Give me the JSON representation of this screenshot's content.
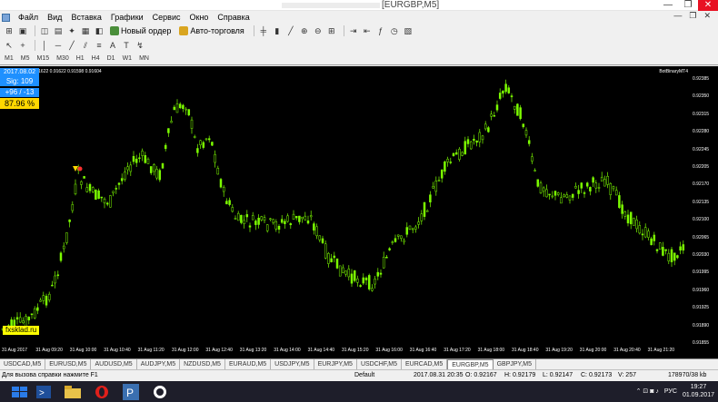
{
  "window": {
    "title": "[EURGBP,M5]",
    "controls": [
      "—",
      "❐",
      "✕"
    ]
  },
  "menu": {
    "items": [
      "Файл",
      "Вид",
      "Вставка",
      "Графики",
      "Сервис",
      "Окно",
      "Справка"
    ],
    "right": [
      "—",
      "❐",
      "✕"
    ]
  },
  "toolbar": {
    "new_order_label": "Новый ордер",
    "auto_trading_label": "Авто-торговля"
  },
  "timeframes": [
    "M1",
    "M5",
    "M15",
    "M30",
    "H1",
    "H4",
    "D1",
    "W1",
    "MN"
  ],
  "chart": {
    "symbol_info": "EURGBP,M5  0.91622 0.91622 0.91598 0.91604",
    "indicator_name": "BotBinaryMT4",
    "panel": {
      "date": "2017.08.02",
      "signal": "Sig: 109",
      "score": "+96 / -13",
      "percent": "87.96 %"
    },
    "watermark": "fxsklad.ru",
    "price_labels": [
      "0.92385",
      "0.92350",
      "0.92315",
      "0.92280",
      "0.92245",
      "0.92205",
      "0.92170",
      "0.92135",
      "0.92100",
      "0.92065",
      "0.92030",
      "0.91995",
      "0.91960",
      "0.91925",
      "0.91890",
      "0.91855"
    ],
    "time_labels": [
      "31 Aug 2017",
      "31 Aug 09:20",
      "31 Aug 10:00",
      "31 Aug 10:40",
      "31 Aug 11:20",
      "31 Aug 12:00",
      "31 Aug 12:40",
      "31 Aug 13:20",
      "31 Aug 14:00",
      "31 Aug 14:40",
      "31 Aug 15:20",
      "31 Aug 16:00",
      "31 Aug 16:40",
      "31 Aug 17:20",
      "31 Aug 18:00",
      "31 Aug 18:40",
      "31 Aug 19:20",
      "31 Aug 20:00",
      "31 Aug 20:40",
      "31 Aug 21:20"
    ],
    "colors": {
      "background": "#000000",
      "candles": "#7cfc00"
    }
  },
  "tabs": [
    "USDCAD,M5",
    "EURUSD,M5",
    "AUDUSD,M5",
    "AUDJPY,M5",
    "NZDUSD,M5",
    "EURAUD,M5",
    "USDJPY,M5",
    "EURJPY,M5",
    "USDCHF,M5",
    "EURCAD,M5",
    "EURGBP,M5",
    "GBPJPY,M5"
  ],
  "active_tab": "EURGBP,M5",
  "status": {
    "help": "Для вызова справки нажмите F1",
    "profile": "Default",
    "datetime": "2017.08.31 20:35",
    "open": "O: 0.92167",
    "high": "H: 0.92179",
    "low": "L: 0.92147",
    "close": "C: 0.92173",
    "volume": "V: 257",
    "traffic": "178970/38 kb"
  },
  "taskbar": {
    "lang": "РУС",
    "time": "19:27",
    "date": "01.09.2017"
  }
}
